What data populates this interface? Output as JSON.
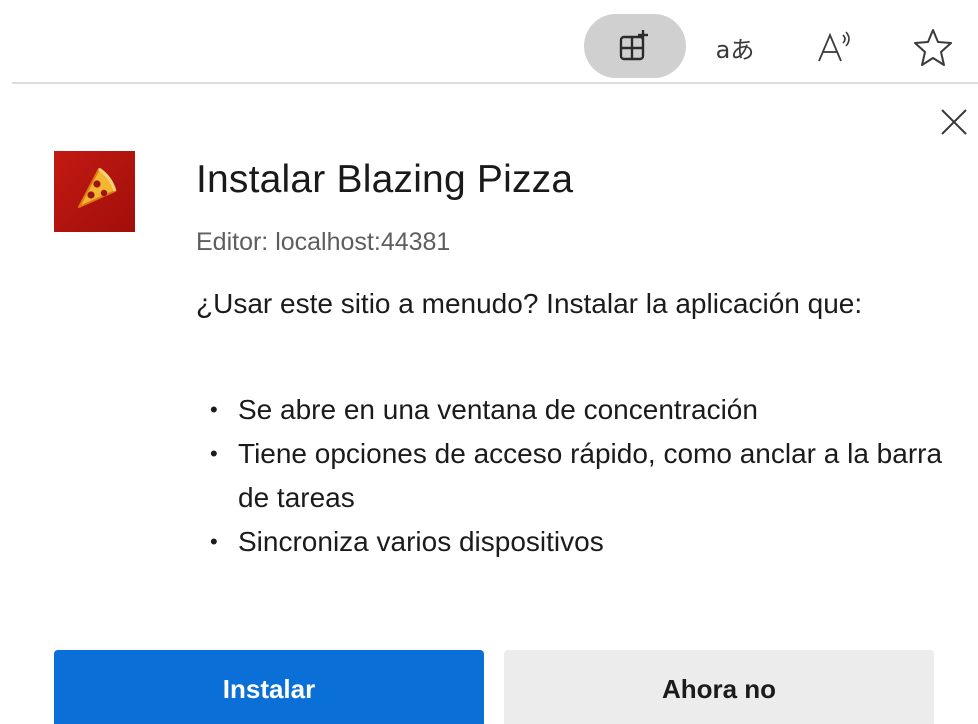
{
  "toolbar": {
    "icons": [
      {
        "name": "app-available-icon"
      },
      {
        "name": "translate-icon",
        "glyph": "aあ"
      },
      {
        "name": "read-aloud-icon"
      },
      {
        "name": "favorite-star-icon"
      }
    ]
  },
  "dialog": {
    "title": "Instalar Blazing Pizza",
    "publisher": "Editor: localhost:44381",
    "description": "¿Usar este sitio a menudo? Instalar la aplicación que:",
    "features": [
      "Se abre en una ventana de concentración",
      "Tiene opciones de acceso rápido, como anclar a la barra de tareas",
      "Sincroniza varios dispositivos"
    ],
    "bullet": "•",
    "install_label": "Instalar",
    "not_now_label": "Ahora no"
  },
  "colors": {
    "install_button": "#0a6fd6",
    "app_icon_bg": "#b5140e",
    "pizza": "#f2b632"
  }
}
